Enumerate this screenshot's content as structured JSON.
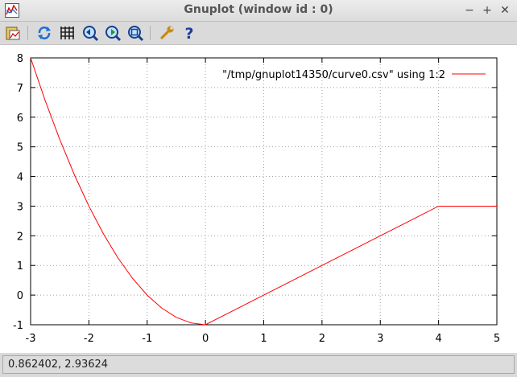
{
  "window": {
    "title": "Gnuplot (window id : 0)",
    "minimize_glyph": "−",
    "maximize_glyph": "+",
    "close_glyph": "✕"
  },
  "toolbar": {
    "items": [
      {
        "name": "copy-to-clipboard-icon"
      },
      {
        "name": "replot-icon"
      },
      {
        "name": "grid-icon"
      },
      {
        "name": "zoom-previous-icon"
      },
      {
        "name": "zoom-next-icon"
      },
      {
        "name": "autoscale-icon"
      },
      {
        "name": "settings-wrench-icon"
      },
      {
        "name": "help-icon"
      }
    ]
  },
  "chart_data": {
    "type": "line",
    "xlim": [
      -3,
      5
    ],
    "ylim": [
      -1,
      8
    ],
    "xticks": [
      -3,
      -2,
      -1,
      0,
      1,
      2,
      3,
      4,
      5
    ],
    "yticks": [
      -1,
      0,
      1,
      2,
      3,
      4,
      5,
      6,
      7,
      8
    ],
    "grid": true,
    "legend_position": "top-right",
    "series": [
      {
        "name": "\"/tmp/gnuplot14350/curve0.csv\" using 1:2",
        "color": "#ff0000",
        "x": [
          -3,
          -2.75,
          -2.5,
          -2.25,
          -2,
          -1.75,
          -1.5,
          -1.25,
          -1,
          -0.75,
          -0.5,
          -0.25,
          0,
          0.5,
          1,
          1.5,
          2,
          2.5,
          3,
          3.5,
          4,
          4.5,
          5
        ],
        "y": [
          8,
          6.5625,
          5.25,
          4.0625,
          3,
          2.0625,
          1.25,
          0.5625,
          0,
          -0.4375,
          -0.75,
          -0.9375,
          -1,
          -0.5,
          0,
          0.5,
          1,
          1.5,
          2,
          2.5,
          3,
          3,
          3
        ]
      }
    ]
  },
  "status": {
    "coordinates": "0.862402,  2.93624"
  }
}
